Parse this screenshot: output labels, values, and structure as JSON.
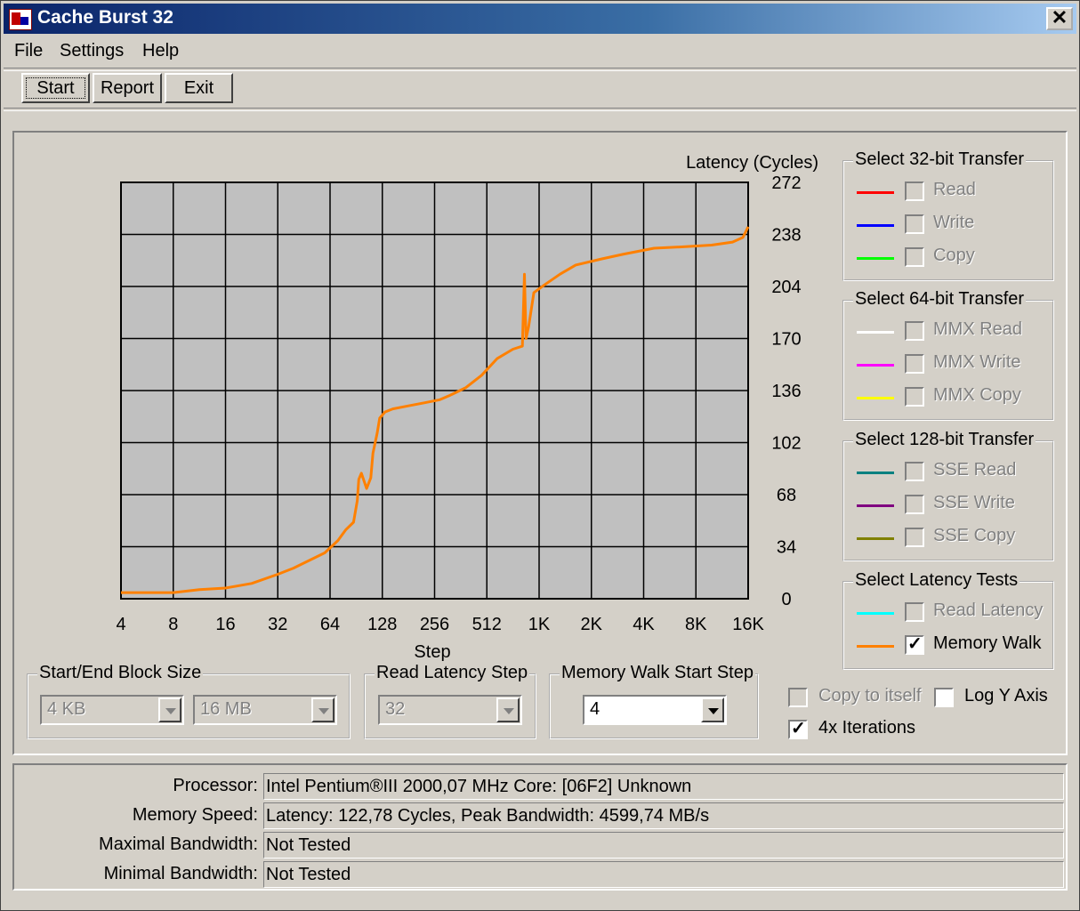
{
  "window": {
    "title": "Cache Burst 32"
  },
  "menu": {
    "file": "File",
    "settings": "Settings",
    "help": "Help"
  },
  "toolbar": {
    "start": "Start",
    "report": "Report",
    "exit": "Exit"
  },
  "chart_data": {
    "type": "line",
    "ylabel": "Latency (Cycles)",
    "xlabel": "Step",
    "yticks": [
      "272",
      "238",
      "204",
      "170",
      "136",
      "102",
      "68",
      "34",
      "0"
    ],
    "xticks": [
      "4",
      "8",
      "16",
      "32",
      "64",
      "128",
      "256",
      "512",
      "1K",
      "2K",
      "4K",
      "8K",
      "16K"
    ],
    "ylim": [
      0,
      272
    ],
    "grid": true,
    "background_color": "#c0c0c0",
    "series": [
      {
        "name": "Memory Walk",
        "color": "#ff8000",
        "points": [
          [
            0,
            4
          ],
          [
            0.5,
            4
          ],
          [
            1,
            4
          ],
          [
            1.5,
            6
          ],
          [
            2,
            7
          ],
          [
            2.5,
            10
          ],
          [
            3,
            16
          ],
          [
            3.3,
            20
          ],
          [
            3.6,
            25
          ],
          [
            3.9,
            30
          ],
          [
            4.15,
            38
          ],
          [
            4.3,
            45
          ],
          [
            4.45,
            50
          ],
          [
            4.52,
            64
          ],
          [
            4.55,
            78
          ],
          [
            4.6,
            82
          ],
          [
            4.7,
            72
          ],
          [
            4.78,
            79
          ],
          [
            4.82,
            95
          ],
          [
            4.9,
            108
          ],
          [
            4.95,
            118
          ],
          [
            5.05,
            122
          ],
          [
            5.2,
            124
          ],
          [
            5.5,
            126
          ],
          [
            5.8,
            128
          ],
          [
            6.1,
            130
          ],
          [
            6.3,
            133
          ],
          [
            6.6,
            138
          ],
          [
            6.9,
            146
          ],
          [
            7.2,
            157
          ],
          [
            7.5,
            163
          ],
          [
            7.68,
            165
          ],
          [
            7.68,
            165
          ],
          [
            7.72,
            212
          ],
          [
            7.75,
            170
          ],
          [
            7.8,
            178
          ],
          [
            7.9,
            200
          ],
          [
            8.1,
            205
          ],
          [
            8.4,
            212
          ],
          [
            8.7,
            218
          ],
          [
            9.2,
            222
          ],
          [
            9.6,
            225
          ],
          [
            10.2,
            229
          ],
          [
            10.8,
            230
          ],
          [
            11.3,
            231
          ],
          [
            11.7,
            233
          ],
          [
            11.9,
            236
          ],
          [
            12,
            243
          ]
        ]
      }
    ]
  },
  "groups": {
    "transfer32": {
      "title": "Select 32-bit Transfer",
      "items": [
        {
          "label": "Read",
          "color": "#ff0000",
          "checked": false
        },
        {
          "label": "Write",
          "color": "#0000ff",
          "checked": false
        },
        {
          "label": "Copy",
          "color": "#00ff00",
          "checked": false
        }
      ]
    },
    "transfer64": {
      "title": "Select 64-bit Transfer",
      "items": [
        {
          "label": "MMX Read",
          "color": "#ffffff",
          "checked": false
        },
        {
          "label": "MMX Write",
          "color": "#ff00ff",
          "checked": false
        },
        {
          "label": "MMX Copy",
          "color": "#ffff00",
          "checked": false
        }
      ]
    },
    "transfer128": {
      "title": "Select 128-bit Transfer",
      "items": [
        {
          "label": "SSE Read",
          "color": "#008080",
          "checked": false
        },
        {
          "label": "SSE Write",
          "color": "#800080",
          "checked": false
        },
        {
          "label": "SSE Copy",
          "color": "#808000",
          "checked": false
        }
      ]
    },
    "latency": {
      "title": "Select Latency Tests",
      "items": [
        {
          "label": "Read Latency",
          "color": "#00ffff",
          "checked": false
        },
        {
          "label": "Memory Walk",
          "color": "#ff8000",
          "checked": true
        }
      ]
    }
  },
  "block_size": {
    "title": "Start/End Block Size",
    "start": "4 KB",
    "end": "16 MB"
  },
  "read_latency_step": {
    "title": "Read Latency Step",
    "value": "32"
  },
  "memory_walk_step": {
    "title": "Memory Walk Start Step",
    "value": "4"
  },
  "options": {
    "copy_to_itself": "Copy to itself",
    "log_y_axis": "Log Y Axis",
    "iterations": "4x Iterations"
  },
  "info": {
    "processor_label": "Processor:",
    "processor_value": "Intel Pentium®III 2000,07 MHz   Core: [06F2] Unknown",
    "memory_speed_label": "Memory Speed:",
    "memory_speed_value": "Latency: 122,78 Cycles, Peak Bandwidth:  4599,74 MB/s",
    "max_bw_label": "Maximal Bandwidth:",
    "max_bw_value": "Not Tested",
    "min_bw_label": "Minimal Bandwidth:",
    "min_bw_value": "Not Tested"
  }
}
